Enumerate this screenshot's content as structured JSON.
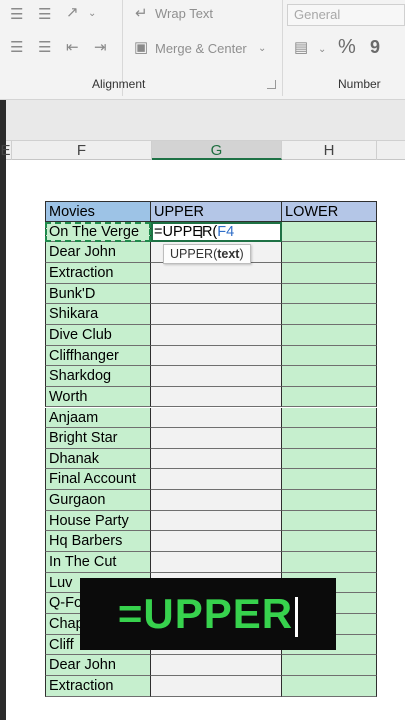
{
  "ribbon": {
    "wrap_text_label": "Wrap Text",
    "merge_center_label": "Merge & Center",
    "number_format_value": "General",
    "alignment_group_label": "Alignment",
    "number_group_label": "Number",
    "percent_symbol": "%",
    "comma_symbol": "9"
  },
  "columns": {
    "e": "E",
    "f": "F",
    "g": "G",
    "h": "H"
  },
  "table": {
    "headers": [
      "Movies",
      "UPPER",
      "LOWER"
    ],
    "movies": [
      "On The Verge",
      "Dear John",
      "Extraction",
      "Bunk'D",
      "Shikara",
      "Dive Club",
      "Cliffhanger",
      "Sharkdog",
      "Worth",
      "Anjaam",
      "Bright Star",
      "Dhanak",
      "Final Account",
      "Gurgaon",
      "House Party",
      "Hq Barbers",
      "In The Cut",
      "Luv",
      "Q-Fo",
      "Chap",
      "Cliff",
      "Dear John",
      "Extraction"
    ]
  },
  "editing": {
    "formula_prefix": "=UPPER(",
    "formula_ref": "F4",
    "tooltip_fn": "UPPER(",
    "tooltip_arg": "text",
    "tooltip_close": ")"
  },
  "caption": {
    "text": "=UPPER"
  },
  "colors": {
    "accent": "#1e7145",
    "movie_fill": "#c6efce",
    "header_fill": "#b4c6e7",
    "caption_text": "#37d24d"
  }
}
